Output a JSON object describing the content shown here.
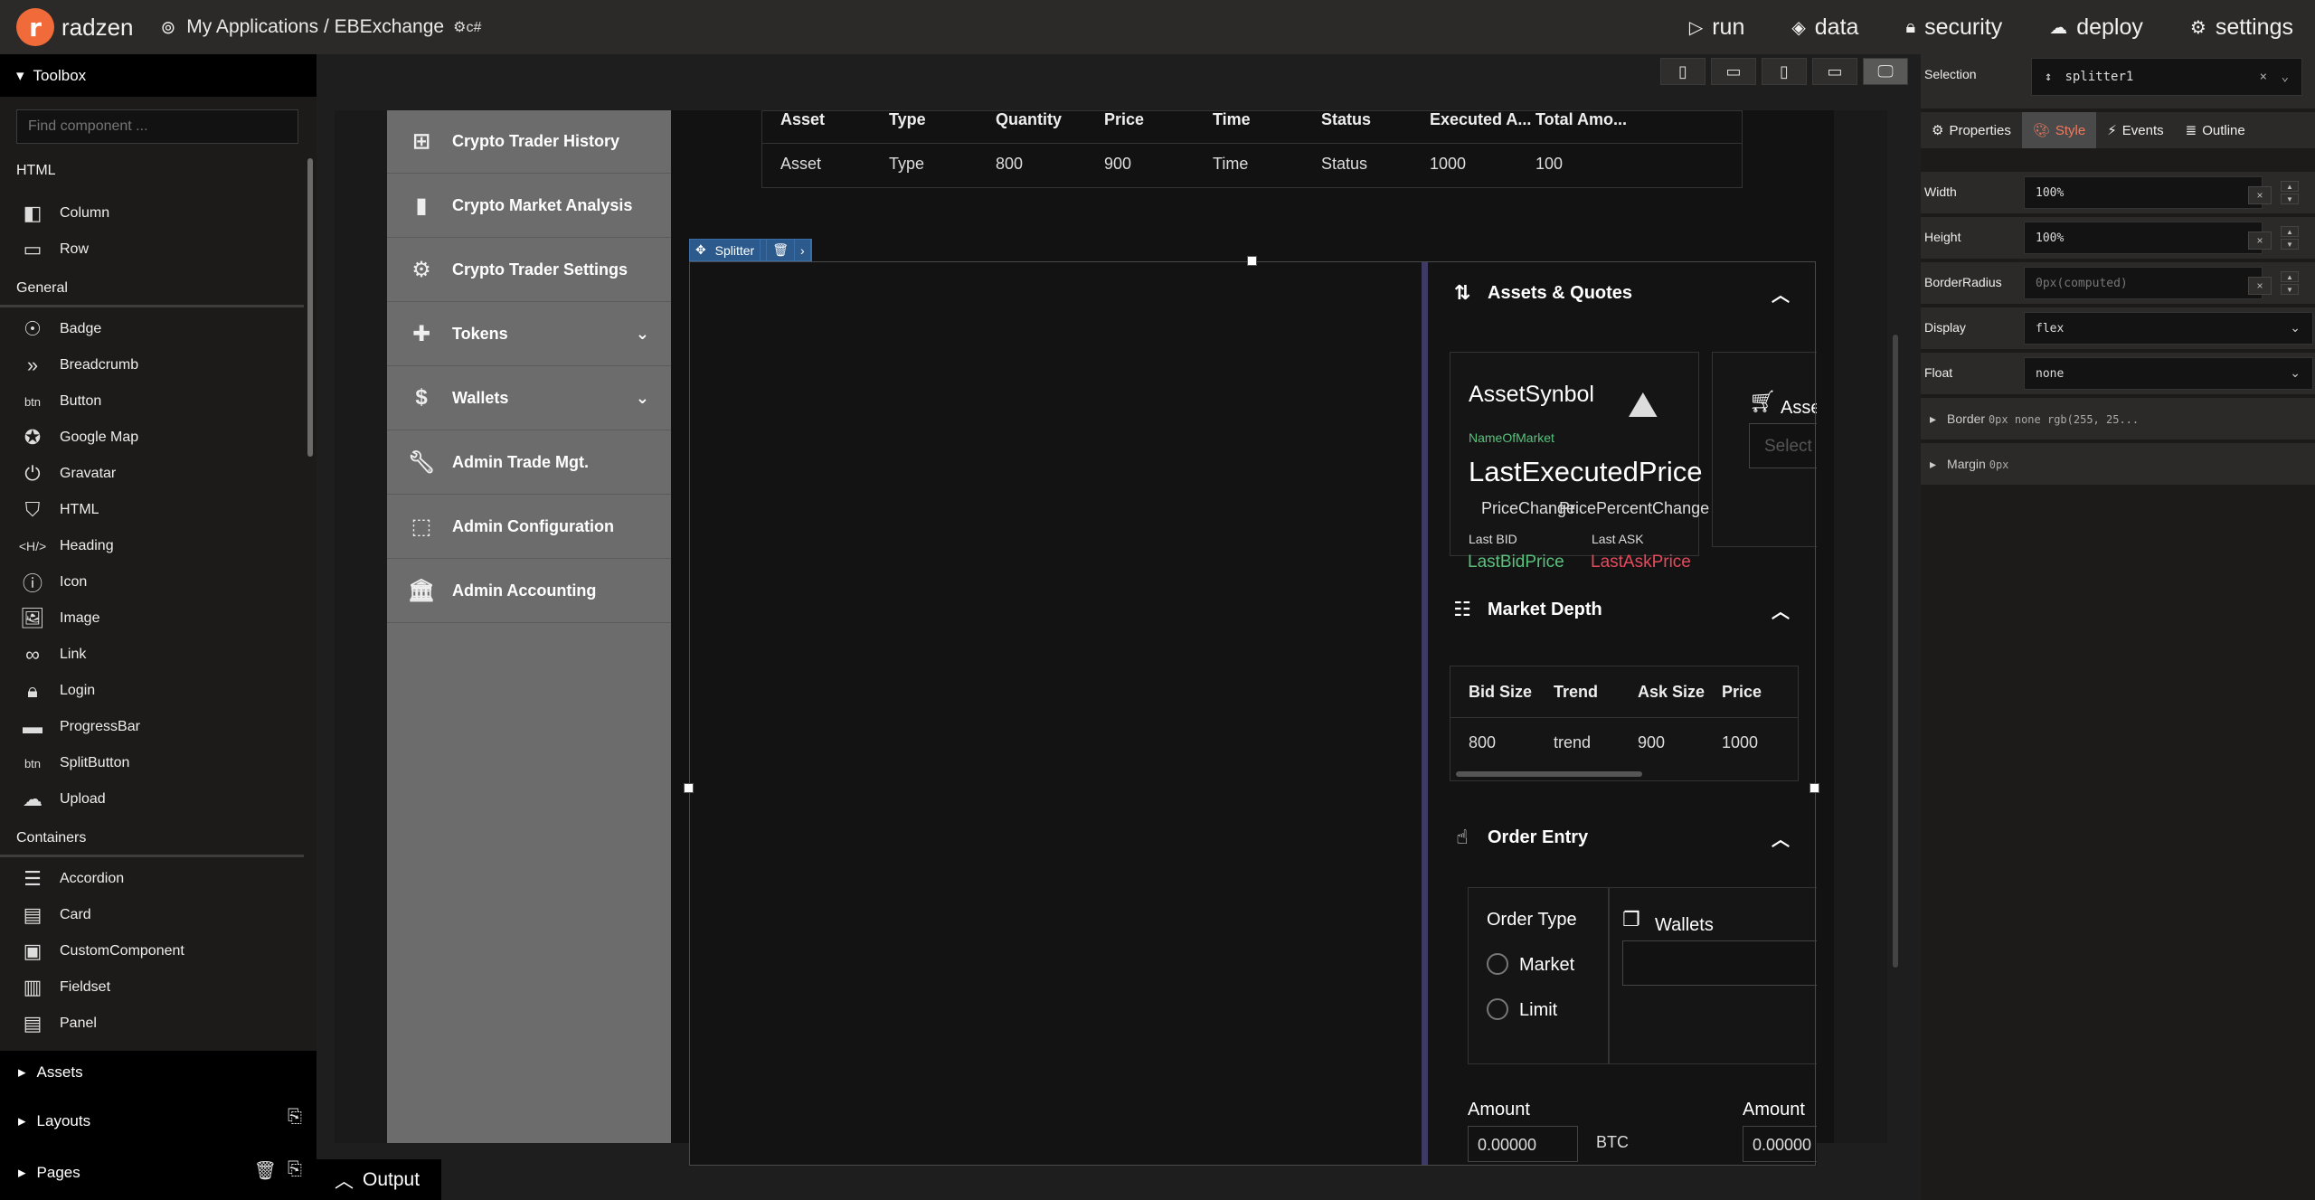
{
  "app": {
    "logo_text": "radzen",
    "logo_letter": "r",
    "breadcrumb": "My Applications / EBExchange",
    "lang": "c#"
  },
  "topnav": {
    "run": "run",
    "data": "data",
    "security": "security",
    "deploy": "deploy",
    "settings": "settings"
  },
  "toolbox": {
    "title": "Toolbox",
    "search_placeholder": "Find component ...",
    "sections": {
      "html": "HTML",
      "general": "General",
      "containers": "Containers"
    },
    "html_items": [
      "Column",
      "Row"
    ],
    "general_items": [
      "Badge",
      "Breadcrumb",
      "Button",
      "Google Map",
      "Gravatar",
      "HTML",
      "Heading",
      "Icon",
      "Image",
      "Link",
      "Login",
      "ProgressBar",
      "SplitButton",
      "Upload"
    ],
    "container_items": [
      "Accordion",
      "Card",
      "CustomComponent",
      "Fieldset",
      "Panel"
    ],
    "accordions": [
      "Assets",
      "Layouts",
      "Pages"
    ]
  },
  "nav_menu": [
    {
      "label": "Crypto Trader History",
      "icon": "tree-icon"
    },
    {
      "label": "Crypto Market Analysis",
      "icon": "bar-chart-icon"
    },
    {
      "label": "Crypto Trader Settings",
      "icon": "gear-icon"
    },
    {
      "label": "Tokens",
      "icon": "puzzle-icon",
      "expand": true
    },
    {
      "label": "Wallets",
      "icon": "dollar-icon",
      "expand": true
    },
    {
      "label": "Admin Trade Mgt.",
      "icon": "wrench-icon"
    },
    {
      "label": "Admin Configuration",
      "icon": "dashed-square-icon"
    },
    {
      "label": "Admin Accounting",
      "icon": "bank-icon"
    }
  ],
  "top_table": {
    "headers": [
      "Asset",
      "Type",
      "Quantity",
      "Price",
      "Time",
      "Status",
      "Executed A...",
      "Total Amo..."
    ],
    "row": [
      "Asset",
      "Type",
      "800",
      "900",
      "Time",
      "Status",
      "1000",
      "100"
    ]
  },
  "splitter": {
    "label": "Splitter"
  },
  "assets_quotes": {
    "title": "Assets & Quotes",
    "symbol": "AssetSynbol",
    "market": "NameOfMarket",
    "last_price": "LastExecutedPrice",
    "price_change": "PriceChange",
    "price_percent": "PricePercentChange",
    "last_bid_label": "Last BID",
    "last_ask_label": "Last ASK",
    "last_bid": "LastBidPrice",
    "last_ask": "LastAskPrice",
    "second_card_title": "Asse",
    "second_card_select": "Select"
  },
  "market_depth": {
    "title": "Market Depth",
    "headers": [
      "Bid Size",
      "Trend",
      "Ask Size",
      "Price"
    ],
    "row": [
      "800",
      "trend",
      "900",
      "1000"
    ]
  },
  "order_entry": {
    "title": "Order Entry",
    "order_type": "Order Type",
    "options": [
      "Market",
      "Limit"
    ],
    "wallets": "Wallets",
    "amount_left": "Amount",
    "amount_right": "Amount",
    "amount_value": "0.00000",
    "currency": "BTC"
  },
  "device_buttons": [
    "phone-portrait",
    "phone-landscape",
    "tablet-portrait",
    "tablet-landscape",
    "desktop"
  ],
  "properties": {
    "selection_label": "Selection",
    "selection_value": "splitter1",
    "tabs": [
      "Properties",
      "Style",
      "Events",
      "Outline"
    ],
    "active_tab": "Style",
    "rows": [
      {
        "label": "Width",
        "value": "100%"
      },
      {
        "label": "Height",
        "value": "100%"
      },
      {
        "label": "BorderRadius",
        "value": "0px(computed)"
      },
      {
        "label": "Display",
        "value": "flex"
      },
      {
        "label": "Float",
        "value": "none"
      }
    ],
    "border": {
      "label": "Border",
      "value": "0px none rgb(255, 25..."
    },
    "margin": {
      "label": "Margin",
      "value": "0px"
    }
  },
  "output": {
    "label": "Output"
  },
  "colors": {
    "accent": "#f06a3a",
    "positive": "#58c27d",
    "negative": "#e7495b",
    "splitter_divider": "#3e3a64"
  }
}
